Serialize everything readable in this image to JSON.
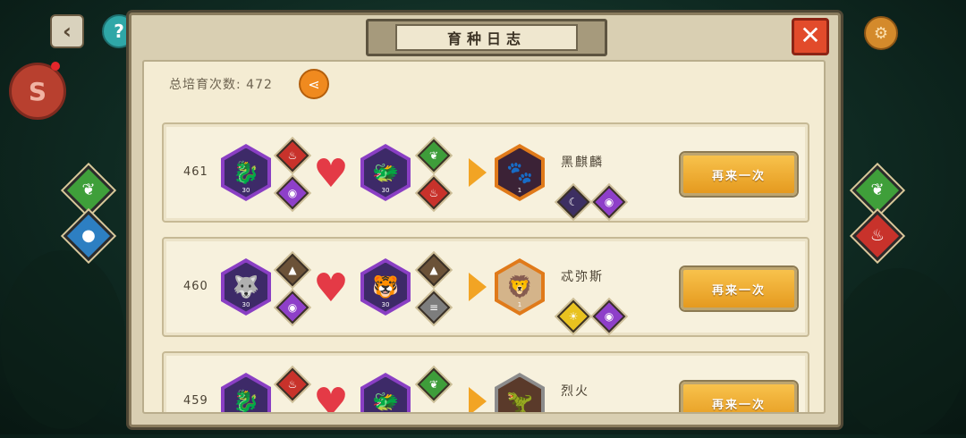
{
  "title": "育种日志",
  "total_label": "总培育次数: 472",
  "records": [
    {
      "num": "461",
      "parent1": {
        "level": "30"
      },
      "parent1_elements": [
        "fire-icon",
        "eye-icon"
      ],
      "parent2": {
        "level": "30"
      },
      "parent2_elements": [
        "grass-icon",
        "fire-icon"
      ],
      "result_name": "黑麒麟",
      "result_level": "1",
      "result_elements": [
        "moon-icon",
        "eye-icon"
      ],
      "button": "再来一次"
    },
    {
      "num": "460",
      "parent1": {
        "level": "30"
      },
      "parent1_elements": [
        "mountain-icon",
        "eye-icon"
      ],
      "parent2": {
        "level": "30"
      },
      "parent2_elements": [
        "mountain-icon",
        "metal-icon"
      ],
      "result_name": "忒弥斯",
      "result_level": "1",
      "result_elements": [
        "sun-icon",
        "eye-icon"
      ],
      "button": "再来一次"
    },
    {
      "num": "459",
      "result_name": "烈火",
      "button": "再来一次"
    }
  ],
  "colors": {
    "accent": "#f2a424",
    "close": "#e24b2b",
    "panel": "#f4ecd3"
  }
}
